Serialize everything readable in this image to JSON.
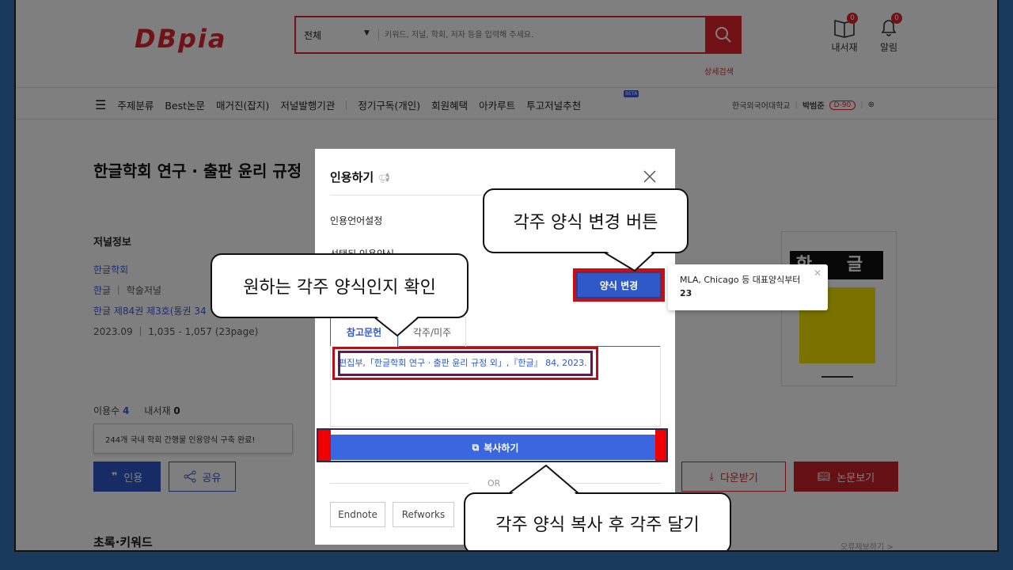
{
  "header": {
    "logo": "DBpia",
    "search_category": "전체",
    "search_placeholder": "키워드, 저널, 학회, 저자 등을 입력해 주세요.",
    "advanced_search": "상세검색",
    "library_label": "내서재",
    "library_badge": "0",
    "alarm_label": "알림",
    "alarm_badge": "0"
  },
  "nav": {
    "items": [
      "주제분류",
      "Best논문",
      "매거진(잡지)",
      "저널발행기관",
      "정기구독(개인)",
      "회원혜택",
      "아카루트",
      "투고저널추천"
    ],
    "beta": "BETA",
    "institution": "한국외국어대학교",
    "user": "박범준",
    "dday": "D-90"
  },
  "article": {
    "title": "한글학회 연구 · 출판 윤리 규정",
    "journal_info_title": "저널정보",
    "publisher": "한글학회",
    "journal": "한글",
    "journal_type": "학술저널",
    "issue": "한글 제84권 제3호(통권 34",
    "date_pages": "2023.09 ｜ 1,035 - 1,057 (23page)",
    "usage_label": "이용수",
    "usage_count": "4",
    "library_label": "내서재",
    "library_count": "0",
    "tooltip": "244개 국내 학회 간행물 인용양식 구축 완료!",
    "cite_button": "인용",
    "share_button": "공유",
    "download_button": "다운받기",
    "view_button": "논문보기",
    "abstract_title": "초록·키워드",
    "report": "오류제보하기 >",
    "cover_title": "한 글"
  },
  "modal": {
    "title": "인용하기",
    "lang_label": "인용언어설정",
    "style_label": "선택된 인용양식",
    "change_button": "양식 변경",
    "tabs": [
      "참고문헌",
      "각주/미주"
    ],
    "citation": "편집부,「한글학회 연구 · 출판 윤리 규정 외」,『한글』 84, 2023.",
    "copy_button": "복사하기",
    "or": "OR",
    "endnote": "Endnote",
    "refworks": "Refworks"
  },
  "popover": {
    "line1": "MLA, Chicago 등 대표양식부터",
    "line2": "23"
  },
  "callouts": {
    "change_style": "각주 양식 변경 버튼",
    "check_style": "원하는 각주 양식인지 확인",
    "copy_note": "각주 양식 복사 후 각주 달기"
  },
  "colors": {
    "brand_red": "#e0252c",
    "primary_blue": "#2f58c8",
    "background_frame": "#1a3a5c"
  }
}
